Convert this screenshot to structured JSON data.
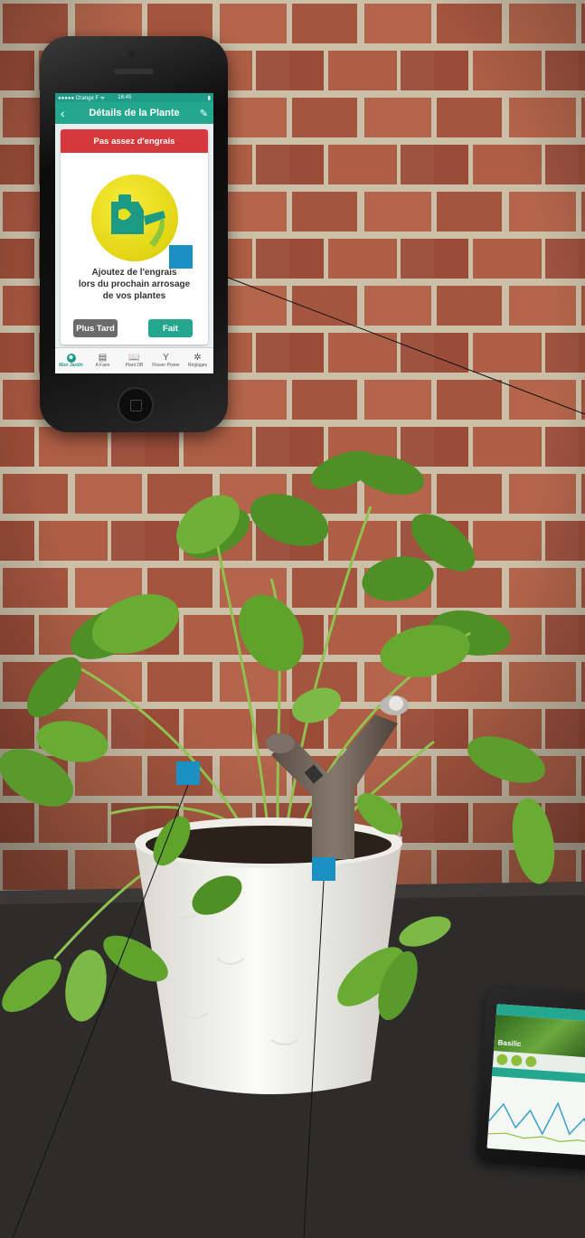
{
  "scene": {
    "subject": "basil-plant-with-sensor",
    "colors": {
      "brick": "#a65a44",
      "mortar": "#cfc3ad",
      "table": "#2d2c2b",
      "pot": "#f2f1ec",
      "sensor": "#6f6258",
      "leaf": "#5a9a2c",
      "marker": "#1b91c3"
    }
  },
  "phone": {
    "status": {
      "carrier": "●●●●● Orange F ᯤ",
      "time": "16:45",
      "battery": "▮"
    },
    "nav": {
      "back_icon": "chevron-left-icon",
      "title": "Détails de la Plante",
      "edit_icon": "pencil-icon"
    },
    "alert": "Pas assez d'engrais",
    "illustration_icon": "fertilizer-can-icon",
    "advice": [
      "Ajoutez de l'engrais",
      "lors du prochain arrosage",
      "de vos plantes"
    ],
    "buttons": {
      "later": "Plus Tard",
      "done": "Fait"
    },
    "tabs": [
      {
        "label": "Mon Jardin",
        "icon": "garden-icon",
        "glyph": "☻",
        "active": true
      },
      {
        "label": "A Faire",
        "icon": "clipboard-icon",
        "glyph": "▤",
        "active": false
      },
      {
        "label": "Plant DB",
        "icon": "book-icon",
        "glyph": "📖",
        "active": false
      },
      {
        "label": "Flower Power",
        "icon": "sensor-icon",
        "glyph": "Y",
        "active": false
      },
      {
        "label": "Réglages",
        "icon": "gear-icon",
        "glyph": "✲",
        "active": false
      }
    ]
  },
  "second_phone": {
    "plant_name": "Basilic"
  }
}
